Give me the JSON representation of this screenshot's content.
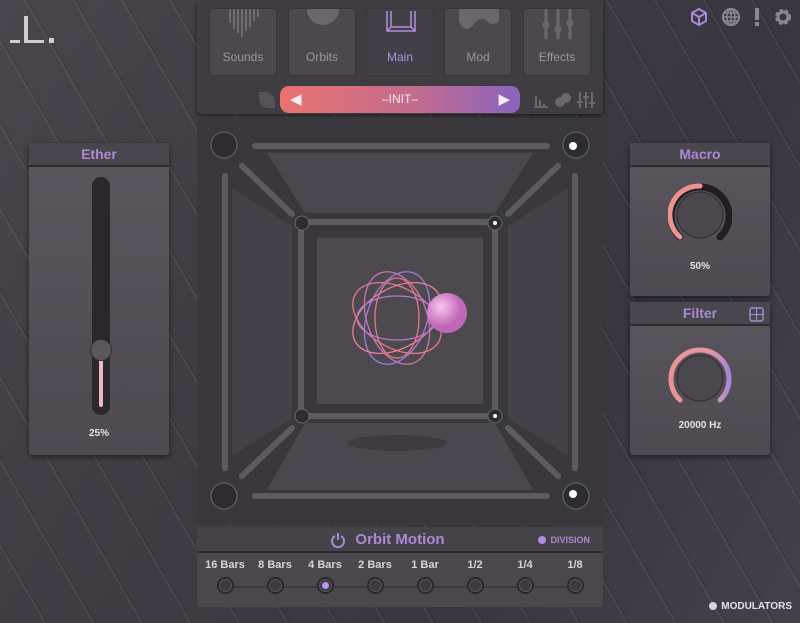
{
  "logo": "_L.",
  "top_icons": [
    "cube-icon",
    "globe-icon",
    "alert-icon",
    "gear-icon"
  ],
  "tabs": [
    {
      "label": "Sounds",
      "active": false
    },
    {
      "label": "Orbits",
      "active": false
    },
    {
      "label": "Main",
      "active": true
    },
    {
      "label": "Mod",
      "active": false
    },
    {
      "label": "Effects",
      "active": false
    }
  ],
  "preset": {
    "name": "–INIT–"
  },
  "ether": {
    "title": "Ether",
    "value": "25%",
    "fraction": 0.25
  },
  "macro": {
    "title": "Macro",
    "value": "50%",
    "fraction": 0.5
  },
  "filter": {
    "title": "Filter",
    "value": "20000 Hz",
    "fraction": 1.0
  },
  "orbit_motion": {
    "title": "Orbit Motion",
    "division_label": "DIVISION",
    "steps": [
      "16 Bars",
      "8 Bars",
      "4 Bars",
      "2 Bars",
      "1 Bar",
      "1/2",
      "1/4",
      "1/8"
    ],
    "selected": "4 Bars"
  },
  "modulators_label": "MODULATORS",
  "colors": {
    "accent": "#a98ad6",
    "preset_start": "#e9736f",
    "preset_end": "#8a63bd"
  }
}
